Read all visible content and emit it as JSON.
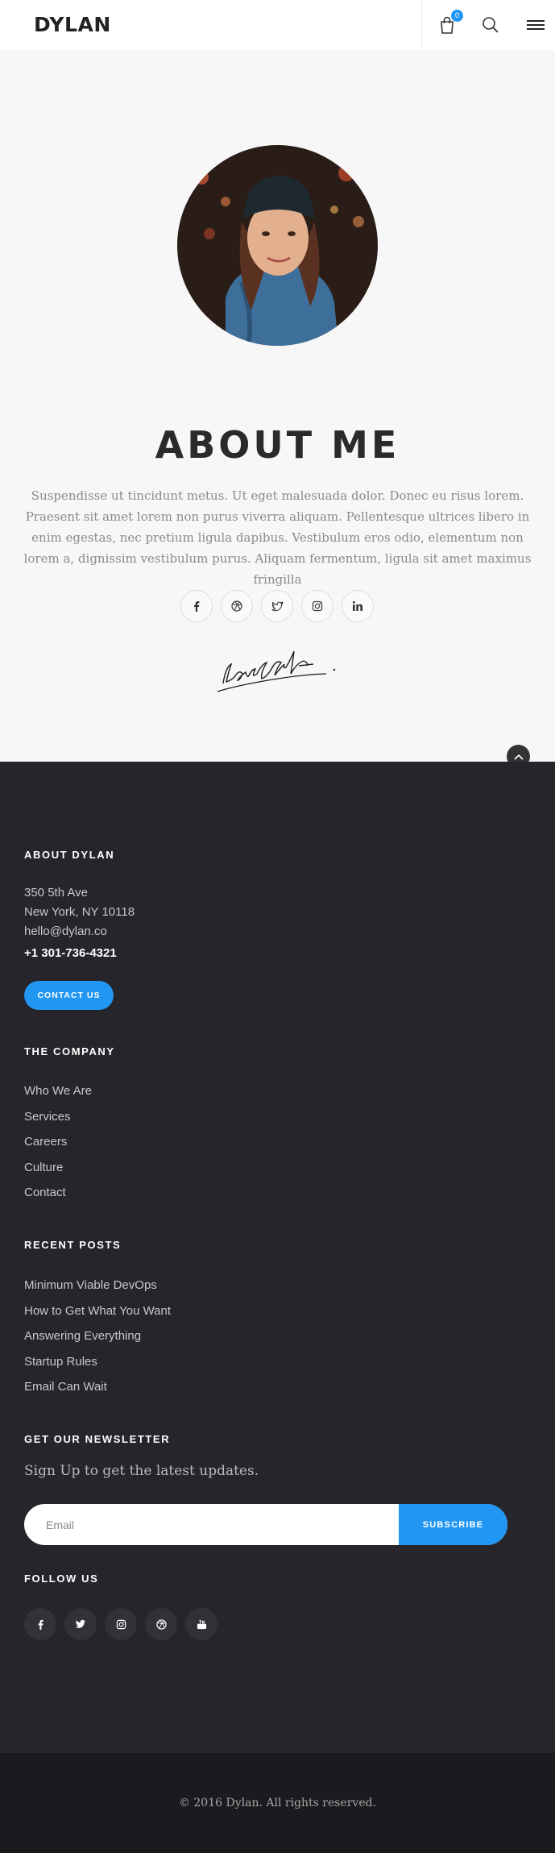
{
  "header": {
    "logo": "DYLAN",
    "cart_count": "0",
    "icons": [
      "shopping-bag-icon",
      "search-icon",
      "menu-icon"
    ]
  },
  "about": {
    "title": "ABOUT ME",
    "text": "Suspendisse ut tincidunt metus. Ut eget malesuada dolor. Donec eu risus lorem. Praesent sit amet lorem non purus viverra aliquam. Pellentesque ultrices libero in enim egestas, nec pretium ligula dapibus. Vestibulum eros odio, elementum non lorem a, dignissim vestibulum purus. Aliquam fermentum, ligula sit amet maximus fringilla",
    "social_icons": [
      "facebook-icon",
      "dribbble-icon",
      "twitter-icon",
      "instagram-icon",
      "linkedin-icon"
    ],
    "signature": "LaraCroft"
  },
  "footer": {
    "about_heading": "ABOUT DYLAN",
    "address_line1": "350 5th Ave",
    "address_line2": "New York, NY 10118",
    "email": "hello@dylan.co",
    "phone": "+1 301-736-4321",
    "contact_button": "CONTACT US",
    "company_heading": "THE COMPANY",
    "company_links": [
      "Who We Are",
      "Services",
      "Careers",
      "Culture",
      "Contact"
    ],
    "posts_heading": "RECENT POSTS",
    "posts": [
      "Minimum Viable DevOps",
      "How to Get What You Want",
      "Answering Everything",
      "Startup Rules",
      "Email Can Wait"
    ],
    "newsletter_heading": "GET OUR NEWSLETTER",
    "newsletter_sub": "Sign Up to get the latest updates.",
    "email_placeholder": "Email",
    "subscribe_button": "SUBSCRIBE",
    "follow_heading": "FOLLOW US",
    "follow_icons": [
      "facebook-icon",
      "twitter-icon",
      "instagram-icon",
      "dribbble-icon",
      "youtube-icon"
    ]
  },
  "copyright": "© 2016 Dylan. All rights reserved.",
  "colors": {
    "accent": "#2196f3",
    "footer_bg": "#25252b",
    "copyright_bg": "#1b1b1f"
  }
}
